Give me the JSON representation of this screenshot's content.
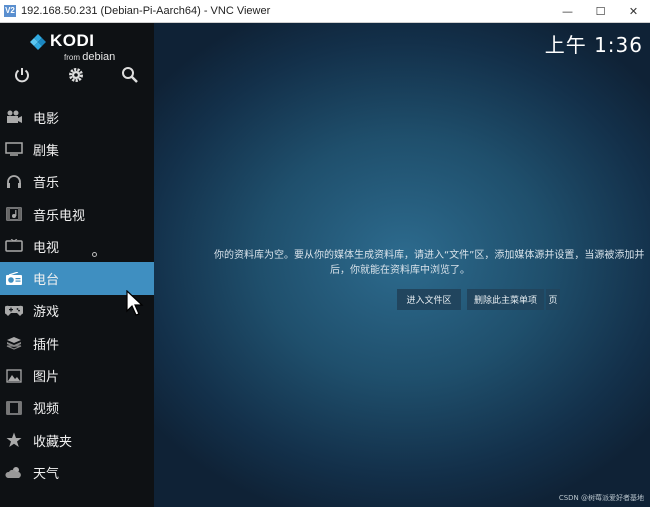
{
  "window": {
    "title": "192.168.50.231 (Debian-Pi-Aarch64) - VNC Viewer",
    "app_icon": "V2",
    "controls": {
      "minimize": "—",
      "maximize": "☐",
      "close": "✕"
    }
  },
  "logo": {
    "name": "KODI",
    "from": "from",
    "distro": "debian"
  },
  "top_icons": [
    "power-icon",
    "settings-gear-icon",
    "search-icon"
  ],
  "menu": [
    {
      "label": "电影",
      "icon": "movies-icon"
    },
    {
      "label": "剧集",
      "icon": "tv-shows-icon"
    },
    {
      "label": "音乐",
      "icon": "headphones-icon"
    },
    {
      "label": "音乐电视",
      "icon": "music-video-icon"
    },
    {
      "label": "电视",
      "icon": "tv-icon"
    },
    {
      "label": "电台",
      "icon": "radio-icon",
      "selected": true
    },
    {
      "label": "游戏",
      "icon": "gamepad-icon"
    },
    {
      "label": "插件",
      "icon": "addons-icon"
    },
    {
      "label": "图片",
      "icon": "pictures-icon"
    },
    {
      "label": "视频",
      "icon": "videos-icon"
    },
    {
      "label": "收藏夹",
      "icon": "star-icon"
    },
    {
      "label": "天气",
      "icon": "weather-icon"
    }
  ],
  "clock": "上午 1:36",
  "message": {
    "line1": "你的资料库为空。要从你的媒体生成资料库，请进入“文件”区，添加媒体源并设置，当源被添加并",
    "line2": "后，你就能在资料库中浏览了。"
  },
  "buttons": {
    "enter_files": "进入文件区",
    "remove_menu": "删除此主菜单项",
    "partial": "页"
  },
  "watermark": "CSDN @树莓派爱好者基地",
  "colors": {
    "selected": "#3f8fc1",
    "sidebar": "#0e1114"
  }
}
